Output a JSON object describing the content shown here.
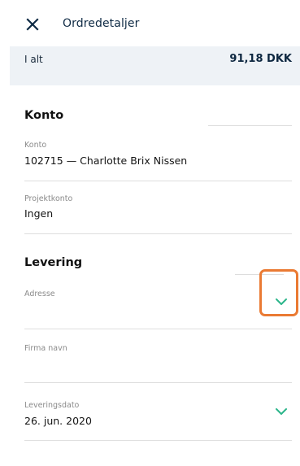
{
  "header": {
    "close_icon": "close-icon",
    "title": "Ordredetaljer"
  },
  "summary": {
    "total_label": "I alt",
    "total_value": "91,18 DKK"
  },
  "account_section": {
    "title": "Konto",
    "account": {
      "label": "Konto",
      "value": "102715 — Charlotte Brix Nissen"
    },
    "project_account": {
      "label": "Projektkonto",
      "value": "Ingen"
    }
  },
  "delivery_section": {
    "title": "Levering",
    "address": {
      "label": "Adresse",
      "value": "",
      "icon": "chevron-down-icon"
    },
    "company_name": {
      "label": "Firma navn",
      "value": ""
    },
    "delivery_date": {
      "label": "Leveringsdato",
      "value": "26. jun. 2020",
      "icon": "chevron-down-icon"
    }
  },
  "colors": {
    "accent_green": "#2bb58a",
    "highlight_orange": "#ea7a33",
    "total_bar_bg": "#eef2f6"
  }
}
